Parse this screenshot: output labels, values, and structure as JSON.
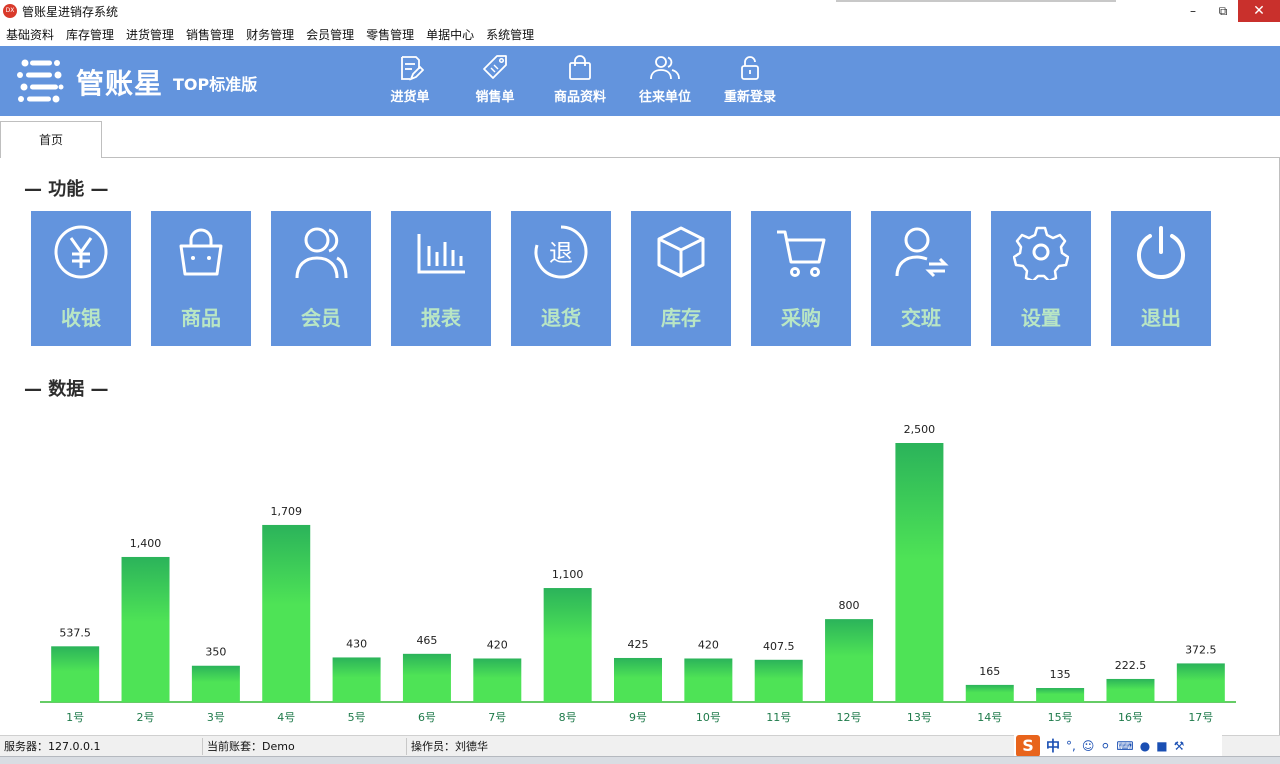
{
  "window": {
    "title": "管账星进销存系统",
    "logo_text": "DX"
  },
  "menu": [
    "基础资料",
    "库存管理",
    "进货管理",
    "销售管理",
    "财务管理",
    "会员管理",
    "零售管理",
    "单据中心",
    "系统管理"
  ],
  "header": {
    "brand": "管账星",
    "edition": "TOP标准版",
    "toolbar": [
      {
        "label": "进货单",
        "icon": "edit-document-icon"
      },
      {
        "label": "销售单",
        "icon": "price-tag-icon"
      },
      {
        "label": "商品资料",
        "icon": "shopping-bag-icon"
      },
      {
        "label": "往来单位",
        "icon": "users-icon"
      },
      {
        "label": "重新登录",
        "icon": "unlock-icon"
      }
    ]
  },
  "tabs": [
    {
      "label": "首页",
      "active": true
    }
  ],
  "sections": {
    "functions": "— 功能 —",
    "data": "— 数据 —"
  },
  "tiles": [
    {
      "label": "收银",
      "icon": "yen-icon"
    },
    {
      "label": "商品",
      "icon": "basket-icon"
    },
    {
      "label": "会员",
      "icon": "members-icon"
    },
    {
      "label": "报表",
      "icon": "bar-chart-icon"
    },
    {
      "label": "退货",
      "icon": "return-icon"
    },
    {
      "label": "库存",
      "icon": "box-icon"
    },
    {
      "label": "采购",
      "icon": "cart-icon"
    },
    {
      "label": "交班",
      "icon": "user-switch-icon"
    },
    {
      "label": "设置",
      "icon": "gear-icon"
    },
    {
      "label": "退出",
      "icon": "power-icon"
    }
  ],
  "chart_data": {
    "type": "bar",
    "categories": [
      "1号",
      "2号",
      "3号",
      "4号",
      "5号",
      "6号",
      "7号",
      "8号",
      "9号",
      "10号",
      "11号",
      "12号",
      "13号",
      "14号",
      "15号",
      "16号",
      "17号"
    ],
    "values": [
      537.5,
      1400,
      350,
      1709,
      430,
      465,
      420,
      1100,
      425,
      420,
      407.5,
      800,
      2500,
      165,
      135,
      222.5,
      372.5
    ],
    "value_labels": [
      "537.5",
      "1,400",
      "350",
      "1,709",
      "430",
      "465",
      "420",
      "1,100",
      "425",
      "420",
      "407.5",
      "800",
      "2,500",
      "165",
      "135",
      "222.5",
      "372.5"
    ],
    "ylim": [
      0,
      2500
    ],
    "grid": false,
    "colors": {
      "bar_top": "#2bb35a",
      "bar_bottom": "#4ee356",
      "axis": "#66cc66",
      "tick_label": "#1e7a4a"
    }
  },
  "status": {
    "server": "服务器：127.0.0.1",
    "account": "当前账套：Demo",
    "operator": "操作员：刘德华"
  },
  "ime": {
    "logo": "S",
    "mode": "中",
    "punct": "°,"
  },
  "colors": {
    "header_bg": "#6394dd",
    "tile_bg": "#6394dd",
    "tile_label": "#b9e6c4"
  }
}
